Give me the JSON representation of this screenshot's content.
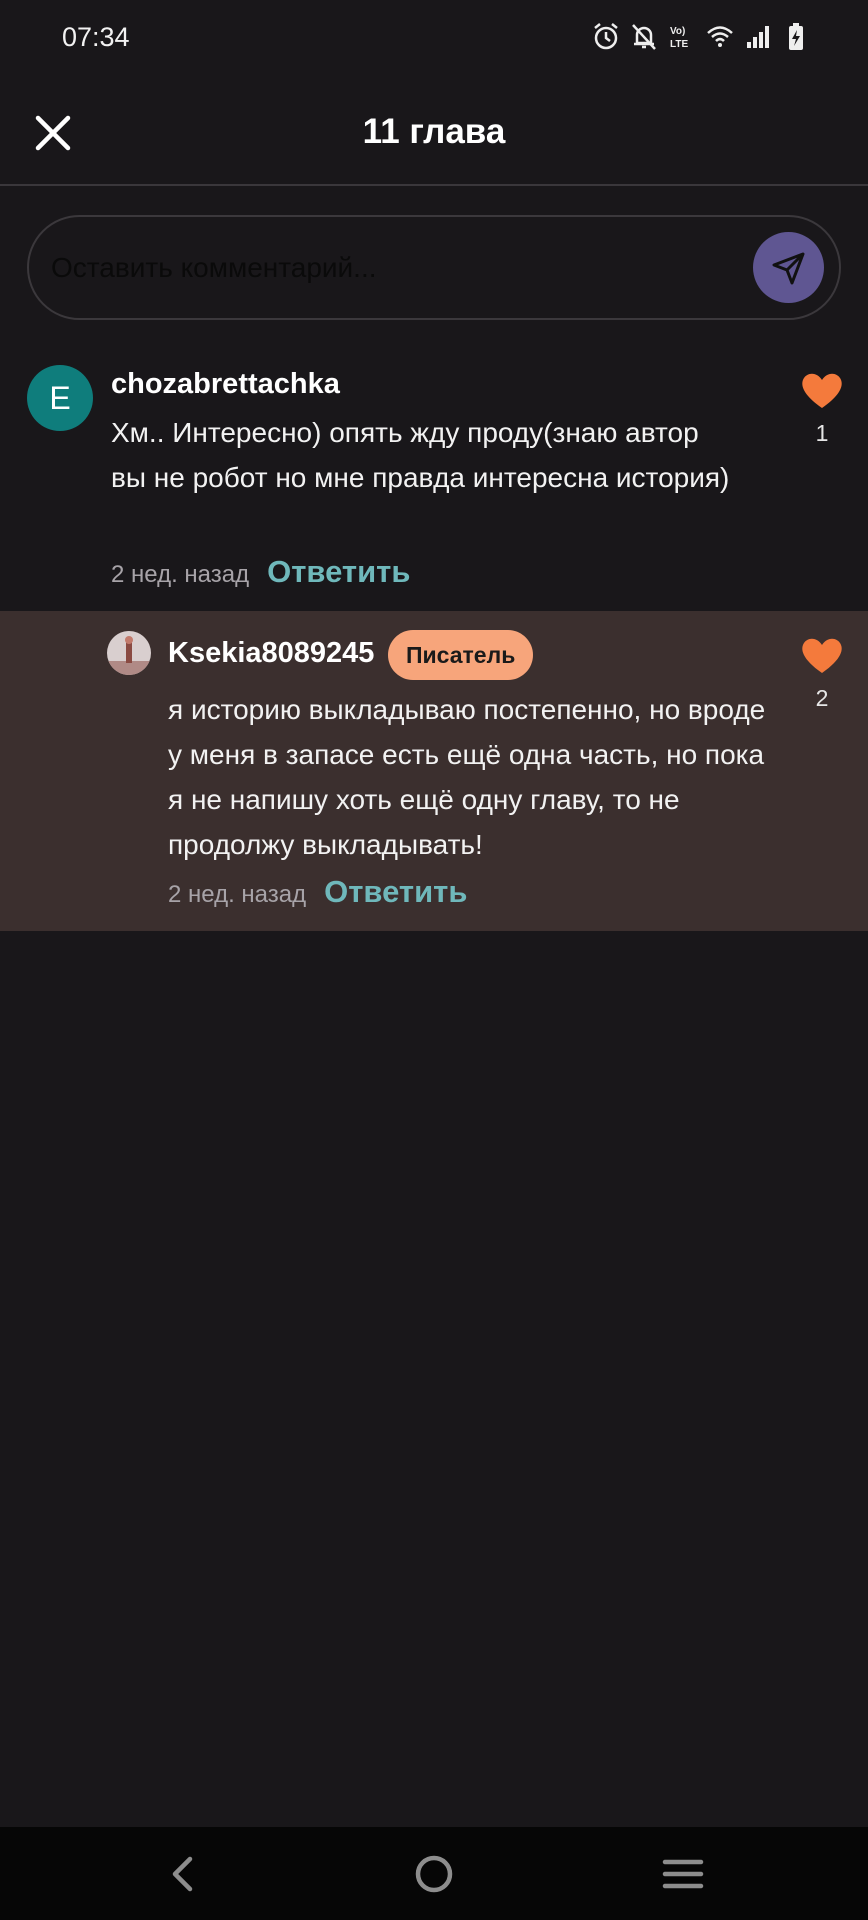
{
  "status_bar": {
    "time": "07:34",
    "icons": [
      "alarm-icon",
      "mute-icon",
      "volte-icon",
      "wifi-icon",
      "signal-icon",
      "battery-charging-icon"
    ]
  },
  "header": {
    "title": "11 глава",
    "close_icon": "close-icon"
  },
  "comment_input": {
    "placeholder": "Оставить комментарий...",
    "value": "",
    "send_icon": "send-icon"
  },
  "comments": [
    {
      "avatar_letter": "E",
      "avatar_color": "#0f7d7c",
      "username": "chozabrettachka",
      "text": "Хм.. Интересно) опять жду проду(знаю автор вы не робот но мне правда интересна история)",
      "time_ago": "2 нед. назад",
      "reply_label": "Ответить",
      "likes": "1"
    },
    {
      "username": "Ksekia8089245",
      "badge": "Писатель",
      "text": "я историю выкладываю постепенно, но вроде у меня в запасе есть ещё одна часть, но пока я не напишу хоть ещё одну главу, то не продолжу выкладывать!",
      "time_ago": "2 нед. назад",
      "reply_label": "Ответить",
      "likes": "2"
    }
  ],
  "colors": {
    "background": "#19171a",
    "reply_highlight": "#3b2f2e",
    "accent_reply": "#6fb8bb",
    "heart": "#f47a3c",
    "badge": "#f7a57b",
    "send_button": "#5f5692"
  },
  "nav_bar": {
    "icons": [
      "back-icon",
      "home-icon",
      "recents-icon"
    ]
  }
}
